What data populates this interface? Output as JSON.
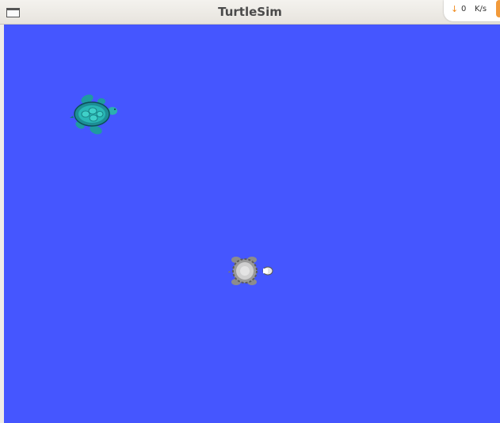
{
  "window": {
    "title": "TurtleSim"
  },
  "netspeed": {
    "arrow_icon": "download-arrow-icon",
    "value": "0",
    "unit": "K/s"
  },
  "canvas": {
    "background": "#4556ff"
  },
  "turtles": [
    {
      "name": "turtle-teal",
      "shell_color": "#23a8a8",
      "icon": "turtle-icon"
    },
    {
      "name": "turtle-gray",
      "shell_color": "#bdbdbd",
      "icon": "turtle-icon"
    }
  ]
}
